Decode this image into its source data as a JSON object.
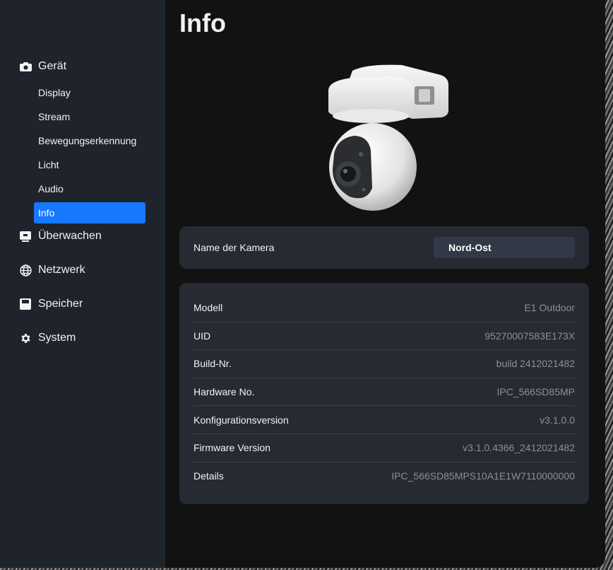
{
  "page": {
    "title": "Info"
  },
  "sidebar": {
    "groups": [
      {
        "label": "Gerät",
        "icon": "camera-icon"
      },
      {
        "label": "Überwachen",
        "icon": "monitor-icon"
      },
      {
        "label": "Netzwerk",
        "icon": "globe-icon"
      },
      {
        "label": "Speicher",
        "icon": "storage-icon"
      },
      {
        "label": "System",
        "icon": "gear-icon"
      }
    ],
    "device_items": [
      {
        "label": "Display"
      },
      {
        "label": "Stream"
      },
      {
        "label": "Bewegungserkennung"
      },
      {
        "label": "Licht"
      },
      {
        "label": "Audio"
      },
      {
        "label": "Info",
        "active": true
      }
    ]
  },
  "camera_name": {
    "label": "Name der Kamera",
    "value": "Nord-Ost"
  },
  "info": {
    "rows": [
      {
        "label": "Modell",
        "value": "E1 Outdoor"
      },
      {
        "label": "UID",
        "value": "95270007583E173X"
      },
      {
        "label": "Build-Nr.",
        "value": "build 2412021482"
      },
      {
        "label": "Hardware No.",
        "value": "IPC_566SD85MP"
      },
      {
        "label": "Konfigurationsversion",
        "value": "v3.1.0.0"
      },
      {
        "label": "Firmware Version",
        "value": "v3.1.0.4366_2412021482"
      },
      {
        "label": "Details",
        "value": "IPC_566SD85MPS10A1E1W7110000000"
      }
    ]
  },
  "colors": {
    "accent": "#1677ff",
    "sidebar_bg": "#1f232b",
    "card_bg": "#262a33",
    "main_bg": "#121212"
  }
}
